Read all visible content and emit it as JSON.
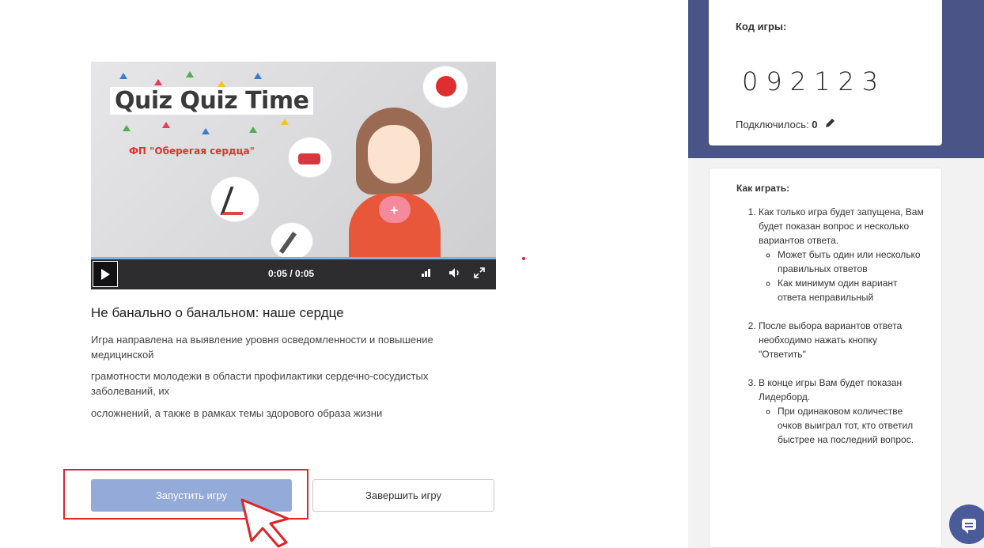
{
  "video": {
    "banner_title": "Quiz Quiz Time",
    "banner_subtitle": "ФП \"Оберегая сердца\"",
    "time": "0:05 / 0:05"
  },
  "game": {
    "title": "Не банально о банальном: наше сердце",
    "description": [
      "Игра направлена на выявление уровня осведомленности и повышение медицинской",
      "грамотности молодежи в области профилактики сердечно-сосудистых заболеваний, их",
      "осложнений, а также в рамках темы здорового образа жизни"
    ]
  },
  "buttons": {
    "start": "Запустить игру",
    "end": "Завершить игру"
  },
  "code_card": {
    "label": "Код игры:",
    "code": "092123",
    "connected_label": "Подключилось:",
    "connected_count": "0"
  },
  "how_to": {
    "title": "Как играть:",
    "steps": [
      {
        "text": "Как только игра будет запущена, Вам будет показан вопрос и несколько вариантов ответа.",
        "sub": [
          "Может быть один или несколько правильных ответов",
          "Как минимум один вариант ответа неправильный"
        ]
      },
      {
        "text": "После выбора вариантов ответа необходимо нажать кнопку \"Ответить\"",
        "sub": []
      },
      {
        "text": "В конце игры Вам будет показан Лидерборд.",
        "sub": [
          "При одинаковом количестве очков выиграл тот, кто ответил быстрее на последний вопрос."
        ]
      }
    ]
  },
  "colors": {
    "accent": "#4a5486",
    "start_button": "#94aad8",
    "highlight": "#e0242a"
  },
  "icons": {
    "play": "play-icon",
    "volume": "volume-icon",
    "fullscreen": "fullscreen-icon",
    "quality": "signal-icon",
    "edit": "pencil-icon",
    "chat": "chat-icon"
  }
}
